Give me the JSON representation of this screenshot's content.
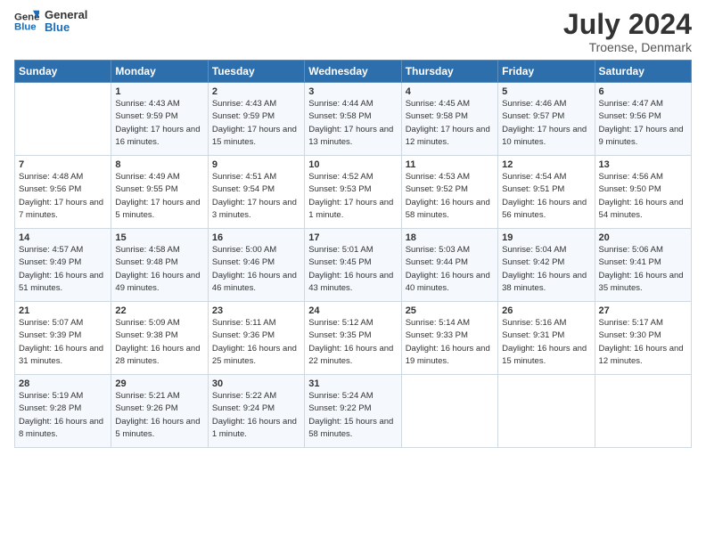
{
  "header": {
    "logo_line1": "General",
    "logo_line2": "Blue",
    "month_title": "July 2024",
    "location": "Troense, Denmark"
  },
  "weekdays": [
    "Sunday",
    "Monday",
    "Tuesday",
    "Wednesday",
    "Thursday",
    "Friday",
    "Saturday"
  ],
  "weeks": [
    [
      {
        "day": "",
        "sunrise": "",
        "sunset": "",
        "daylight": ""
      },
      {
        "day": "1",
        "sunrise": "Sunrise: 4:43 AM",
        "sunset": "Sunset: 9:59 PM",
        "daylight": "Daylight: 17 hours and 16 minutes."
      },
      {
        "day": "2",
        "sunrise": "Sunrise: 4:43 AM",
        "sunset": "Sunset: 9:59 PM",
        "daylight": "Daylight: 17 hours and 15 minutes."
      },
      {
        "day": "3",
        "sunrise": "Sunrise: 4:44 AM",
        "sunset": "Sunset: 9:58 PM",
        "daylight": "Daylight: 17 hours and 13 minutes."
      },
      {
        "day": "4",
        "sunrise": "Sunrise: 4:45 AM",
        "sunset": "Sunset: 9:58 PM",
        "daylight": "Daylight: 17 hours and 12 minutes."
      },
      {
        "day": "5",
        "sunrise": "Sunrise: 4:46 AM",
        "sunset": "Sunset: 9:57 PM",
        "daylight": "Daylight: 17 hours and 10 minutes."
      },
      {
        "day": "6",
        "sunrise": "Sunrise: 4:47 AM",
        "sunset": "Sunset: 9:56 PM",
        "daylight": "Daylight: 17 hours and 9 minutes."
      }
    ],
    [
      {
        "day": "7",
        "sunrise": "Sunrise: 4:48 AM",
        "sunset": "Sunset: 9:56 PM",
        "daylight": "Daylight: 17 hours and 7 minutes."
      },
      {
        "day": "8",
        "sunrise": "Sunrise: 4:49 AM",
        "sunset": "Sunset: 9:55 PM",
        "daylight": "Daylight: 17 hours and 5 minutes."
      },
      {
        "day": "9",
        "sunrise": "Sunrise: 4:51 AM",
        "sunset": "Sunset: 9:54 PM",
        "daylight": "Daylight: 17 hours and 3 minutes."
      },
      {
        "day": "10",
        "sunrise": "Sunrise: 4:52 AM",
        "sunset": "Sunset: 9:53 PM",
        "daylight": "Daylight: 17 hours and 1 minute."
      },
      {
        "day": "11",
        "sunrise": "Sunrise: 4:53 AM",
        "sunset": "Sunset: 9:52 PM",
        "daylight": "Daylight: 16 hours and 58 minutes."
      },
      {
        "day": "12",
        "sunrise": "Sunrise: 4:54 AM",
        "sunset": "Sunset: 9:51 PM",
        "daylight": "Daylight: 16 hours and 56 minutes."
      },
      {
        "day": "13",
        "sunrise": "Sunrise: 4:56 AM",
        "sunset": "Sunset: 9:50 PM",
        "daylight": "Daylight: 16 hours and 54 minutes."
      }
    ],
    [
      {
        "day": "14",
        "sunrise": "Sunrise: 4:57 AM",
        "sunset": "Sunset: 9:49 PM",
        "daylight": "Daylight: 16 hours and 51 minutes."
      },
      {
        "day": "15",
        "sunrise": "Sunrise: 4:58 AM",
        "sunset": "Sunset: 9:48 PM",
        "daylight": "Daylight: 16 hours and 49 minutes."
      },
      {
        "day": "16",
        "sunrise": "Sunrise: 5:00 AM",
        "sunset": "Sunset: 9:46 PM",
        "daylight": "Daylight: 16 hours and 46 minutes."
      },
      {
        "day": "17",
        "sunrise": "Sunrise: 5:01 AM",
        "sunset": "Sunset: 9:45 PM",
        "daylight": "Daylight: 16 hours and 43 minutes."
      },
      {
        "day": "18",
        "sunrise": "Sunrise: 5:03 AM",
        "sunset": "Sunset: 9:44 PM",
        "daylight": "Daylight: 16 hours and 40 minutes."
      },
      {
        "day": "19",
        "sunrise": "Sunrise: 5:04 AM",
        "sunset": "Sunset: 9:42 PM",
        "daylight": "Daylight: 16 hours and 38 minutes."
      },
      {
        "day": "20",
        "sunrise": "Sunrise: 5:06 AM",
        "sunset": "Sunset: 9:41 PM",
        "daylight": "Daylight: 16 hours and 35 minutes."
      }
    ],
    [
      {
        "day": "21",
        "sunrise": "Sunrise: 5:07 AM",
        "sunset": "Sunset: 9:39 PM",
        "daylight": "Daylight: 16 hours and 31 minutes."
      },
      {
        "day": "22",
        "sunrise": "Sunrise: 5:09 AM",
        "sunset": "Sunset: 9:38 PM",
        "daylight": "Daylight: 16 hours and 28 minutes."
      },
      {
        "day": "23",
        "sunrise": "Sunrise: 5:11 AM",
        "sunset": "Sunset: 9:36 PM",
        "daylight": "Daylight: 16 hours and 25 minutes."
      },
      {
        "day": "24",
        "sunrise": "Sunrise: 5:12 AM",
        "sunset": "Sunset: 9:35 PM",
        "daylight": "Daylight: 16 hours and 22 minutes."
      },
      {
        "day": "25",
        "sunrise": "Sunrise: 5:14 AM",
        "sunset": "Sunset: 9:33 PM",
        "daylight": "Daylight: 16 hours and 19 minutes."
      },
      {
        "day": "26",
        "sunrise": "Sunrise: 5:16 AM",
        "sunset": "Sunset: 9:31 PM",
        "daylight": "Daylight: 16 hours and 15 minutes."
      },
      {
        "day": "27",
        "sunrise": "Sunrise: 5:17 AM",
        "sunset": "Sunset: 9:30 PM",
        "daylight": "Daylight: 16 hours and 12 minutes."
      }
    ],
    [
      {
        "day": "28",
        "sunrise": "Sunrise: 5:19 AM",
        "sunset": "Sunset: 9:28 PM",
        "daylight": "Daylight: 16 hours and 8 minutes."
      },
      {
        "day": "29",
        "sunrise": "Sunrise: 5:21 AM",
        "sunset": "Sunset: 9:26 PM",
        "daylight": "Daylight: 16 hours and 5 minutes."
      },
      {
        "day": "30",
        "sunrise": "Sunrise: 5:22 AM",
        "sunset": "Sunset: 9:24 PM",
        "daylight": "Daylight: 16 hours and 1 minute."
      },
      {
        "day": "31",
        "sunrise": "Sunrise: 5:24 AM",
        "sunset": "Sunset: 9:22 PM",
        "daylight": "Daylight: 15 hours and 58 minutes."
      },
      {
        "day": "",
        "sunrise": "",
        "sunset": "",
        "daylight": ""
      },
      {
        "day": "",
        "sunrise": "",
        "sunset": "",
        "daylight": ""
      },
      {
        "day": "",
        "sunrise": "",
        "sunset": "",
        "daylight": ""
      }
    ]
  ]
}
